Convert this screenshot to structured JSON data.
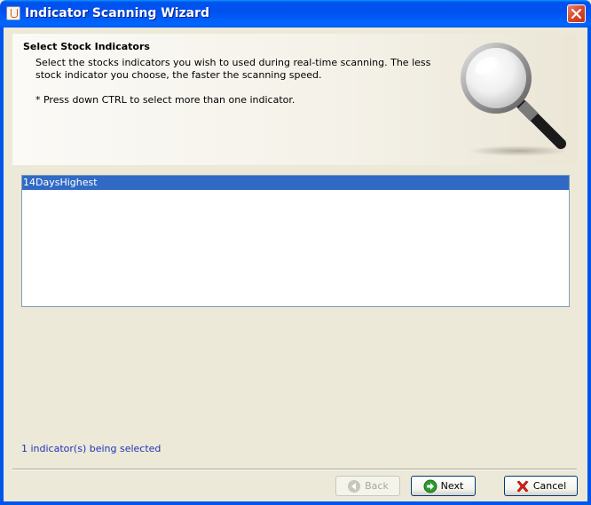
{
  "window": {
    "title": "Indicator Scanning Wizard"
  },
  "header": {
    "title": "Select Stock Indicators",
    "description": "Select the stocks indicators you wish to used during real-time scanning. The less stock indicator you choose, the faster the scanning speed.",
    "note": "* Press down CTRL to select more than one indicator."
  },
  "list": {
    "items": [
      {
        "label": "14DaysHighest",
        "selected": true
      }
    ]
  },
  "status": {
    "text": "1 indicator(s) being selected"
  },
  "buttons": {
    "back": "Back",
    "next": "Next",
    "cancel": "Cancel"
  },
  "icons": {
    "title": "java-cup-icon",
    "close": "close-icon",
    "magnifier": "magnifier-icon",
    "back": "back-arrow-icon",
    "next": "next-arrow-icon",
    "cancel": "red-x-icon"
  },
  "colors": {
    "titlebar": "#0054e3",
    "selection": "#316ac5",
    "status_text": "#1b34b8"
  }
}
